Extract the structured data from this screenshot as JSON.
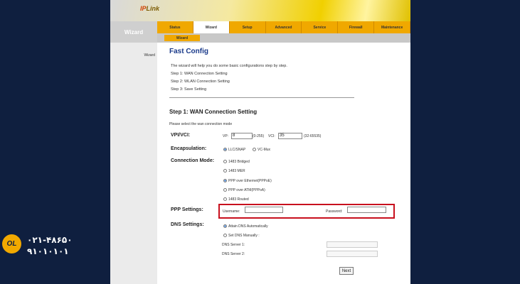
{
  "colors": {
    "nav": "#f0a800",
    "title": "#1a3a8a",
    "highlight": "#c8101e",
    "page_bg": "#0f1f3f"
  },
  "header": {
    "logo_prefix": "IP",
    "logo_text": "Link"
  },
  "sidebar": {
    "title": "Wizard",
    "item": "Wizard"
  },
  "nav": {
    "tabs": [
      "Status",
      "Wizard",
      "Setup",
      "Advanced",
      "Service",
      "Firewall",
      "Maintenance"
    ],
    "active": "Wizard"
  },
  "subnav": {
    "active": "Wizard"
  },
  "main": {
    "title": "Fast Config",
    "intro": [
      "The wizard will help you do some basic configurations step by step.",
      "Step 1: WAN Connection Setting",
      "Step 2: WLAN Connection Setting",
      "Step 3: Save Setting"
    ],
    "step_title": "Step 1: WAN Connection Setting",
    "select_text": "Please select the wan connection mode",
    "vpi_vci": {
      "label": "VPI/VCI:",
      "vp_label": "VP:",
      "vp_value": "8",
      "vp_range": "(0-255)",
      "vci_label": "VCI:",
      "vci_value": "35",
      "vci_range": "(32-65535)"
    },
    "encapsulation": {
      "label": "Encapsulation:",
      "options": [
        "LLC/SNAP",
        "VC-Mux"
      ],
      "selected": "LLC/SNAP"
    },
    "connection_mode": {
      "label": "Connection Mode:",
      "options": [
        "1483 Bridged",
        "1483 MER",
        "PPP over Ethernet(PPPoE)",
        "PPP over ATM(PPPoA)",
        "1483 Routed"
      ],
      "selected": "PPP over Ethernet(PPPoE)"
    },
    "ppp": {
      "label": "PPP Settings:",
      "username_label": "Username:",
      "username_value": "",
      "password_label": "Password:",
      "password_value": ""
    },
    "dns": {
      "label": "DNS Settings:",
      "options": [
        "Attain DNS Automatically",
        "Set DNS Manually :"
      ],
      "selected": "Attain DNS Automatically",
      "server1_label": "DNS Server 1:",
      "server1_value": "",
      "server2_label": "DNS Server 2:",
      "server2_value": ""
    },
    "next_label": "Next"
  },
  "brand": {
    "logo": "OL",
    "phone1": "۰۲۱-۴۸۶۵۰",
    "phone2": "۹۱۰۱۰۱۰۱"
  }
}
